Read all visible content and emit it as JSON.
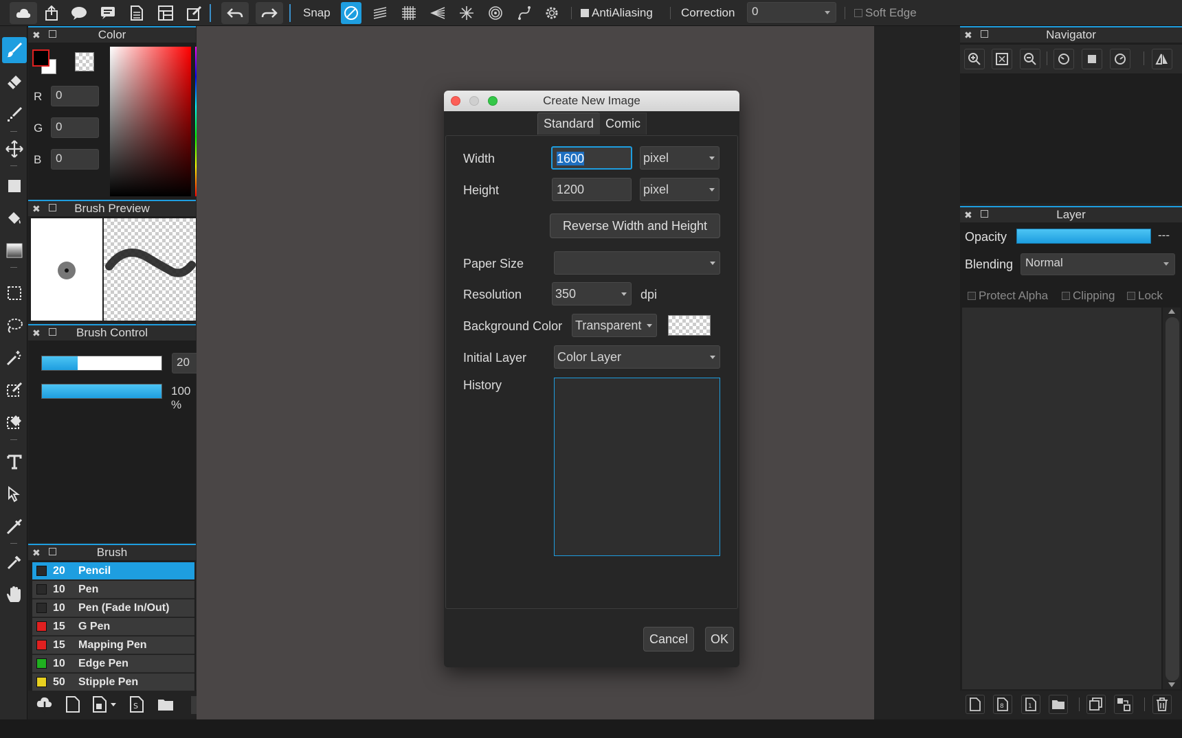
{
  "toolbar": {
    "snap_label": "Snap",
    "antialiasing_label": "AntiAliasing",
    "correction_label": "Correction",
    "correction_value": "0",
    "soft_edge_label": "Soft Edge"
  },
  "color_panel": {
    "title": "Color",
    "r_label": "R",
    "r_value": "0",
    "g_label": "G",
    "g_value": "0",
    "b_label": "B",
    "b_value": "0",
    "foreground": "#000000",
    "background": "#ffffff"
  },
  "brush_preview": {
    "title": "Brush Preview"
  },
  "brush_control": {
    "title": "Brush Control",
    "size_value": "20",
    "opacity_value": "100 %",
    "size_fraction": 0.3,
    "opacity_fraction": 1.0
  },
  "brush_panel": {
    "title": "Brush",
    "items": [
      {
        "size": "20",
        "name": "Pencil",
        "color": "#2a2a2a"
      },
      {
        "size": "10",
        "name": "Pen",
        "color": "#2a2a2a"
      },
      {
        "size": "10",
        "name": "Pen (Fade In/Out)",
        "color": "#2a2a2a"
      },
      {
        "size": "15",
        "name": "G Pen",
        "color": "#e02020"
      },
      {
        "size": "15",
        "name": "Mapping Pen",
        "color": "#e02020"
      },
      {
        "size": "10",
        "name": "Edge Pen",
        "color": "#20b020"
      },
      {
        "size": "50",
        "name": "Stipple Pen",
        "color": "#e8d020"
      }
    ]
  },
  "navigator": {
    "title": "Navigator"
  },
  "layer_panel": {
    "title": "Layer",
    "opacity_label": "Opacity",
    "opacity_value": "---",
    "blending_label": "Blending",
    "blending_value": "Normal",
    "protect_alpha_label": "Protect Alpha",
    "clipping_label": "Clipping",
    "lock_label": "Lock"
  },
  "dialog": {
    "title": "Create New Image",
    "tabs": [
      "Standard",
      "Comic"
    ],
    "width_label": "Width",
    "width_value": "1600",
    "width_unit": "pixel",
    "height_label": "Height",
    "height_value": "1200",
    "height_unit": "pixel",
    "reverse_label": "Reverse Width and Height",
    "paper_size_label": "Paper Size",
    "paper_size_value": "",
    "resolution_label": "Resolution",
    "resolution_value": "350",
    "resolution_unit": "dpi",
    "bg_color_label": "Background Color",
    "bg_color_value": "Transparent",
    "initial_layer_label": "Initial Layer",
    "initial_layer_value": "Color Layer",
    "history_label": "History",
    "cancel_label": "Cancel",
    "ok_label": "OK"
  },
  "colors": {
    "accent": "#1e9ee0"
  }
}
